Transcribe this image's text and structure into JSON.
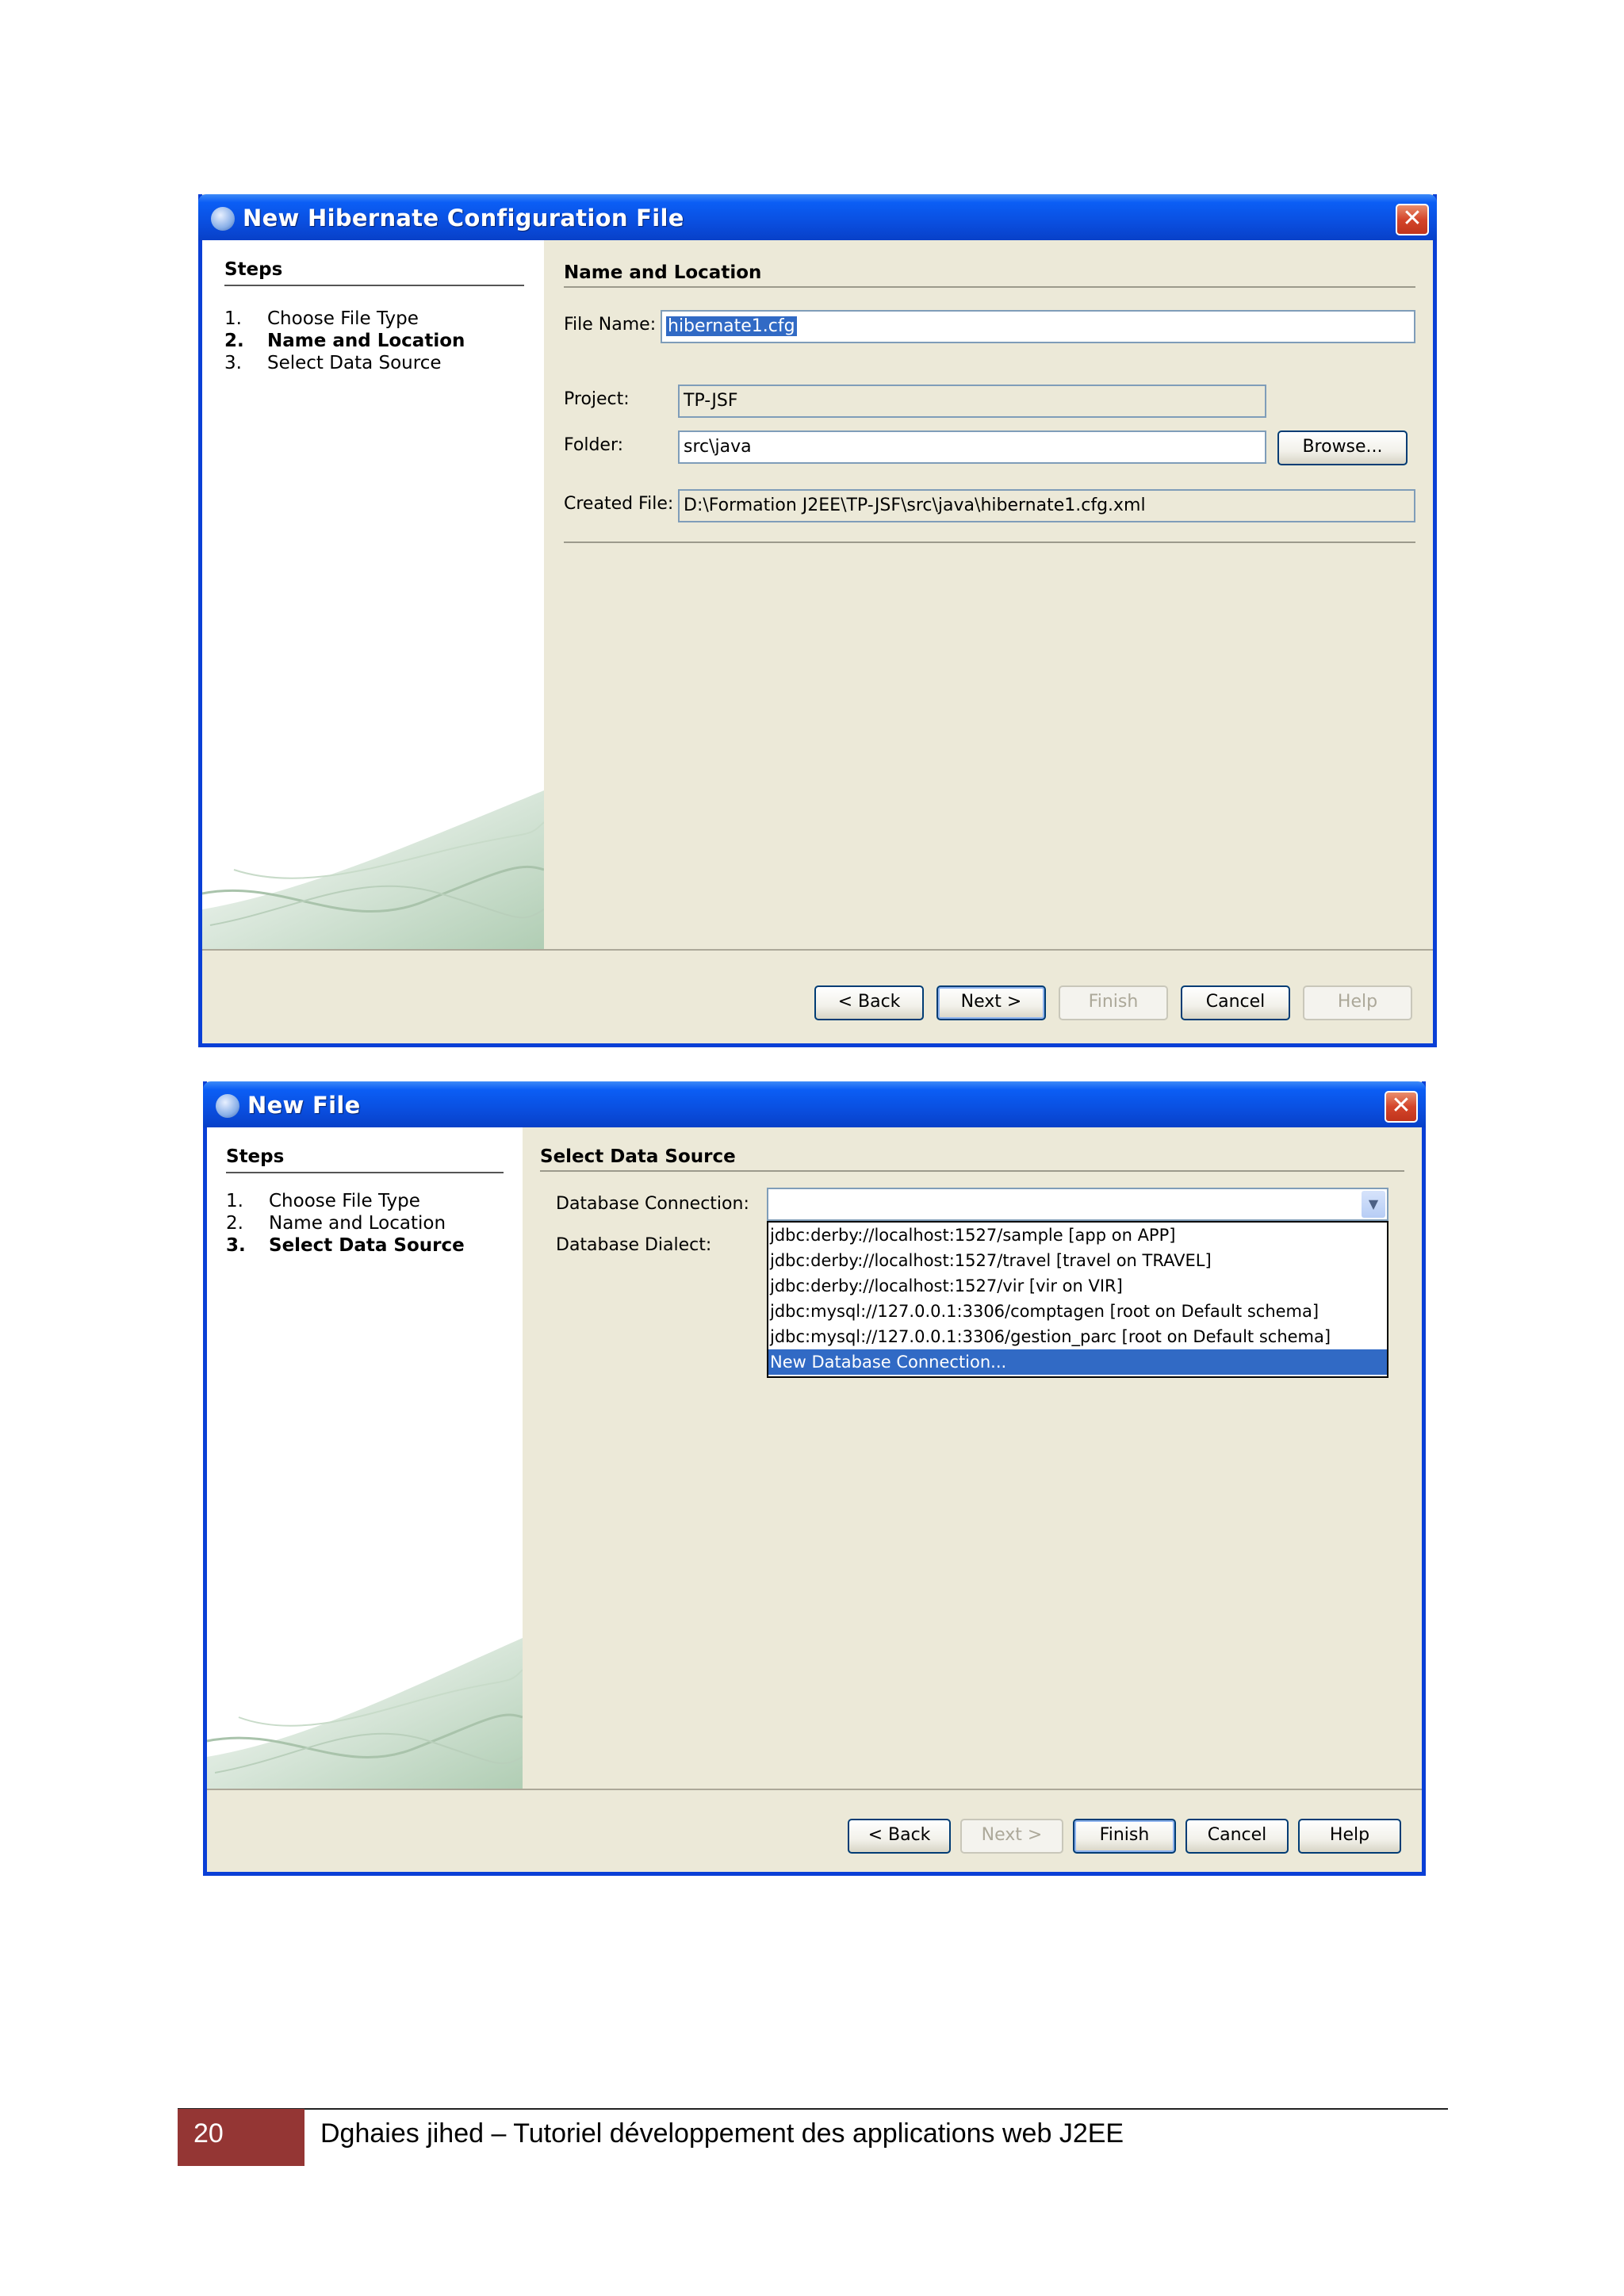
{
  "dialog1": {
    "title": "New Hibernate Configuration File",
    "steps_heading": "Steps",
    "steps": [
      {
        "num": "1.",
        "label": "Choose File Type"
      },
      {
        "num": "2.",
        "label": "Name and Location"
      },
      {
        "num": "3.",
        "label": "Select Data Source"
      }
    ],
    "current_step": 2,
    "section_heading": "Name and Location",
    "file_name_label": "File Name:",
    "file_name_value": "hibernate1.cfg",
    "project_label": "Project:",
    "project_value": "TP-JSF",
    "folder_label": "Folder:",
    "folder_value": "src\\java",
    "browse_label": "Browse...",
    "created_file_label": "Created File:",
    "created_file_value": "D:\\Formation J2EE\\TP-JSF\\src\\java\\hibernate1.cfg.xml",
    "buttons": {
      "back": "< Back",
      "next": "Next >",
      "finish": "Finish",
      "cancel": "Cancel",
      "help": "Help"
    }
  },
  "dialog2": {
    "title": "New File",
    "steps_heading": "Steps",
    "steps": [
      {
        "num": "1.",
        "label": "Choose File Type"
      },
      {
        "num": "2.",
        "label": "Name and Location"
      },
      {
        "num": "3.",
        "label": "Select Data Source"
      }
    ],
    "current_step": 3,
    "section_heading": "Select Data Source",
    "db_connection_label": "Database Connection:",
    "db_dialect_label": "Database Dialect:",
    "db_connection_value": "",
    "connections": [
      "jdbc:derby://localhost:1527/sample [app on APP]",
      "jdbc:derby://localhost:1527/travel [travel on TRAVEL]",
      "jdbc:derby://localhost:1527/vir [vir on VIR]",
      "jdbc:mysql://127.0.0.1:3306/comptagen [root on Default schema]",
      "jdbc:mysql://127.0.0.1:3306/gestion_parc [root on Default schema]",
      "New Database Connection..."
    ],
    "selected_connection_index": 5,
    "buttons": {
      "back": "< Back",
      "next": "Next >",
      "finish": "Finish",
      "cancel": "Cancel",
      "help": "Help"
    }
  },
  "footer": {
    "page_number": "20",
    "text": "Dghaies jihed – Tutoriel développement des applications web  J2EE"
  },
  "colors": {
    "titlebar": "#0a4fe0",
    "selection": "#316ac5",
    "footer_box": "#943634",
    "dialog_bg": "#ece9d8"
  }
}
